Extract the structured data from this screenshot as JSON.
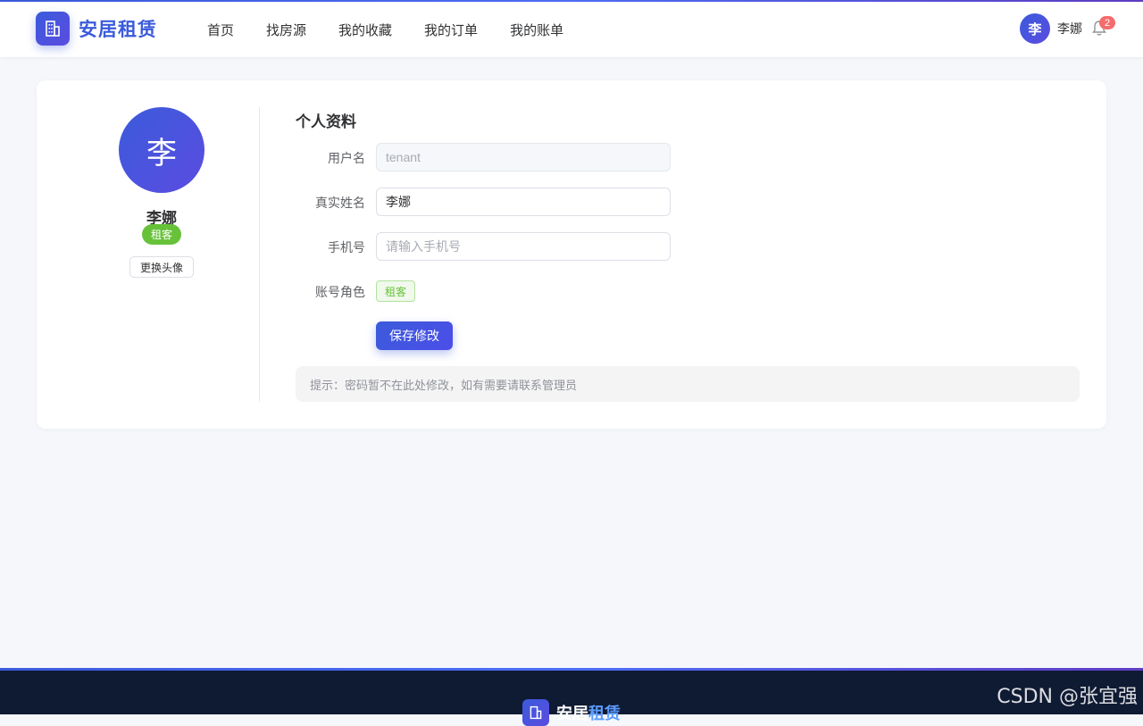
{
  "header": {
    "logo_text": "安居租赁",
    "nav": [
      "首页",
      "找房源",
      "我的收藏",
      "我的订单",
      "我的账单"
    ],
    "user_avatar_char": "李",
    "user_name": "李娜",
    "notification_count": "2"
  },
  "profile": {
    "avatar_char": "李",
    "name": "李娜",
    "role_badge": "租客",
    "change_avatar_label": "更换头像"
  },
  "form": {
    "title": "个人资料",
    "username_label": "用户名",
    "username_value": "tenant",
    "realname_label": "真实姓名",
    "realname_value": "李娜",
    "phone_label": "手机号",
    "phone_placeholder": "请输入手机号",
    "role_label": "账号角色",
    "role_value": "租客",
    "save_label": "保存修改",
    "tip": "提示：密码暂不在此处修改，如有需要请联系管理员"
  },
  "footer": {
    "logo_part1": "安居",
    "logo_part2": "租赁"
  },
  "watermark": "CSDN @张宜强",
  "colors": {
    "primary": "#3b5bdb",
    "success": "#67c23a",
    "danger": "#f56c6c",
    "footer_bg": "#0f1a33"
  }
}
